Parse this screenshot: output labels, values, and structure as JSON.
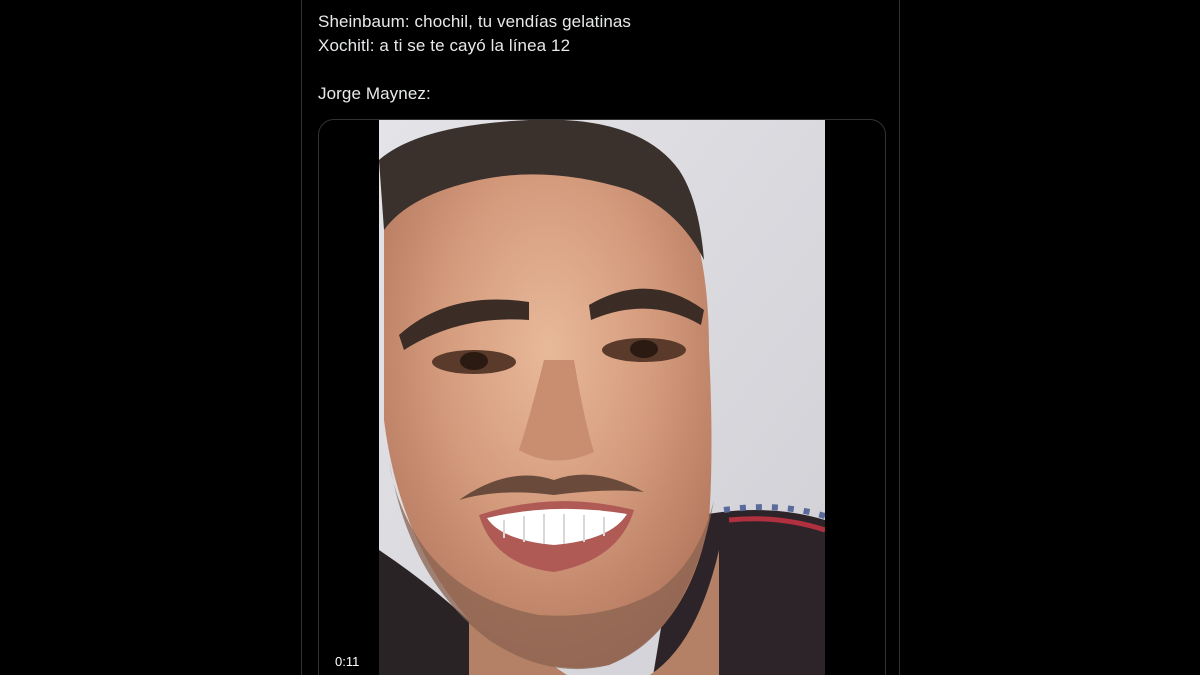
{
  "tweet": {
    "lines": [
      "Sheinbaum: chochil, tu vendías gelatinas",
      "Xochitl: a ti se te cayó la línea 12",
      "",
      "Jorge Maynez:"
    ]
  },
  "media": {
    "type": "video",
    "thumbnail_subject": "smiling-man-face",
    "elapsed_time": "0:11"
  },
  "colors": {
    "background": "#000000",
    "text": "#e7e9ea",
    "border": "#2f3336"
  }
}
